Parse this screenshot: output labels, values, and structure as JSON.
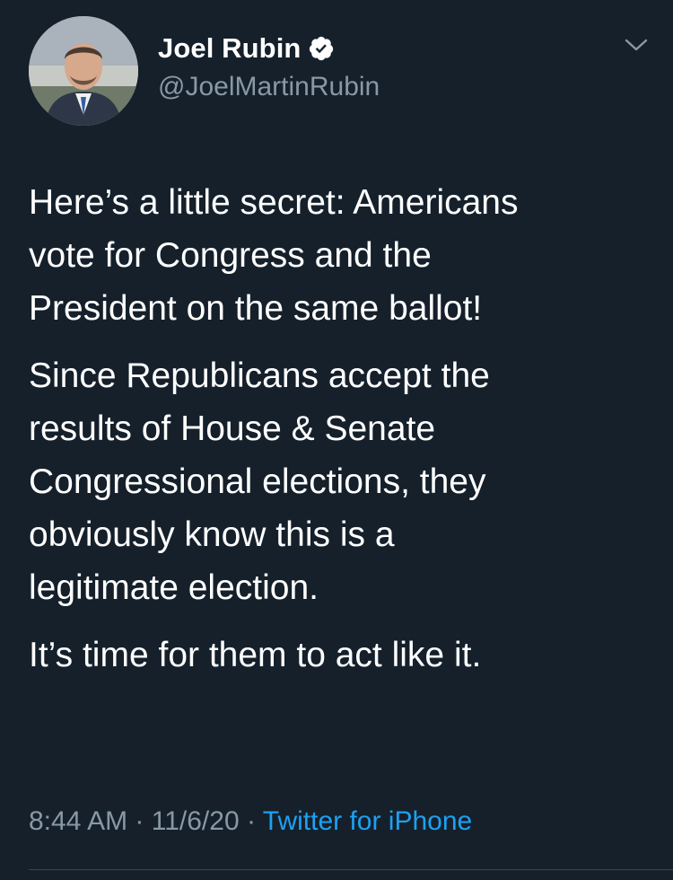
{
  "tweet": {
    "author": {
      "name": "Joel Rubin",
      "handle": "@JoelMartinRubin",
      "verified": true
    },
    "paragraphs": [
      "Here’s a little secret: Americans\nvote for Congress and the\nPresident on the same ballot!",
      "Since Republicans accept the\nresults of House & Senate\nCongressional elections, they\nobviously know this is a\nlegitimate election.",
      "It’s time for them to act like it."
    ],
    "time": "8:44 AM",
    "separator": "·",
    "date": "11/6/20",
    "source": "Twitter for iPhone"
  },
  "colors": {
    "background": "#15202b",
    "text": "#ffffff",
    "secondary_text": "#8899a6",
    "link": "#1da1f2",
    "divider": "#38444d"
  },
  "icons": {
    "verified": "verified-badge-icon",
    "more": "chevron-down-icon"
  }
}
